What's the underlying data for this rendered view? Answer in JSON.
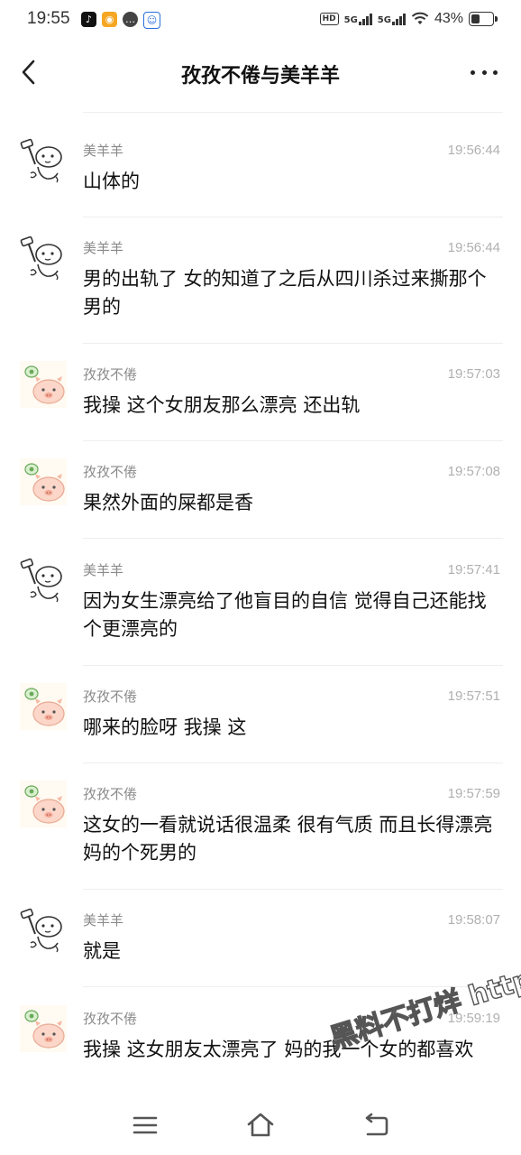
{
  "status_bar": {
    "time": "19:55",
    "app_icons": [
      "tiktok-icon",
      "weibo-icon",
      "message-icon",
      "baby-icon"
    ],
    "hd_badge": "HD",
    "network_1": "5G",
    "network_2": "5G",
    "battery_percent": "43%",
    "battery_level": 0.43
  },
  "header": {
    "title": "孜孜不倦与美羊羊"
  },
  "messages": [
    {
      "sender": "美羊羊",
      "time": "19:56:44",
      "text": "山体的",
      "avatar": "sheep-hammer-avatar"
    },
    {
      "sender": "美羊羊",
      "time": "19:56:44",
      "text": "男的出轨了  女的知道了之后从四川杀过来撕那个男的",
      "avatar": "sheep-hammer-avatar"
    },
    {
      "sender": "孜孜不倦",
      "time": "19:57:03",
      "text": "我操  这个女朋友那么漂亮  还出轨",
      "avatar": "pig-avatar"
    },
    {
      "sender": "孜孜不倦",
      "time": "19:57:08",
      "text": "果然外面的屎都是香",
      "avatar": "pig-avatar"
    },
    {
      "sender": "美羊羊",
      "time": "19:57:41",
      "text": "因为女生漂亮给了他盲目的自信  觉得自己还能找个更漂亮的",
      "avatar": "sheep-hammer-avatar"
    },
    {
      "sender": "孜孜不倦",
      "time": "19:57:51",
      "text": "哪来的脸呀  我操  这",
      "avatar": "pig-avatar"
    },
    {
      "sender": "孜孜不倦",
      "time": "19:57:59",
      "text": "这女的一看就说话很温柔  很有气质  而且长得漂亮  妈的个死男的",
      "avatar": "pig-avatar"
    },
    {
      "sender": "美羊羊",
      "time": "19:58:07",
      "text": "就是",
      "avatar": "sheep-hammer-avatar"
    },
    {
      "sender": "孜孜不倦",
      "time": "19:59:19",
      "text": "我操  这女朋友太漂亮了  妈的我一个女的都喜欢",
      "avatar": "pig-avatar"
    }
  ],
  "watermark": "黑料不打烊 https://bdy.co",
  "nav": {
    "icons": [
      "menu-icon",
      "home-icon",
      "back-icon"
    ]
  }
}
